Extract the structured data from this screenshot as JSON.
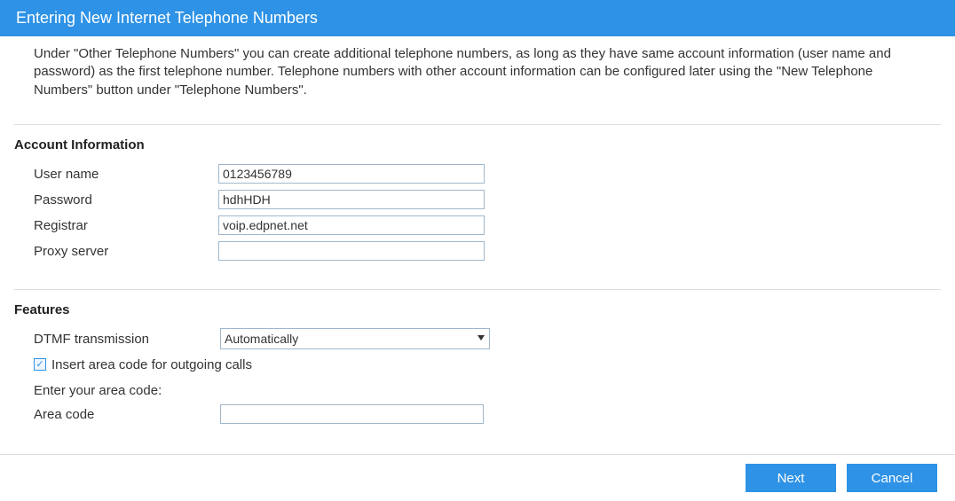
{
  "title": "Entering New Internet Telephone Numbers",
  "intro": "Under \"Other Telephone Numbers\" you can create additional telephone numbers, as long as they have same account information (user name and password) as the first telephone number. Telephone numbers with other account information can be configured later using the \"New Telephone Numbers\" button under \"Telephone Numbers\".",
  "account": {
    "section_label": "Account Information",
    "username_label": "User name",
    "username_value": "0123456789",
    "password_label": "Password",
    "password_value": "hdhHDH",
    "registrar_label": "Registrar",
    "registrar_value": "voip.edpnet.net",
    "proxy_label": "Proxy server",
    "proxy_value": ""
  },
  "features": {
    "section_label": "Features",
    "dtmf_label": "DTMF transmission",
    "dtmf_value": "Automatically",
    "insert_areacode_checked": true,
    "insert_areacode_label": "Insert area code for outgoing calls",
    "enter_areacode_label": "Enter your area code:",
    "areacode_label": "Area code",
    "areacode_value": ""
  },
  "buttons": {
    "next": "Next",
    "cancel": "Cancel"
  }
}
